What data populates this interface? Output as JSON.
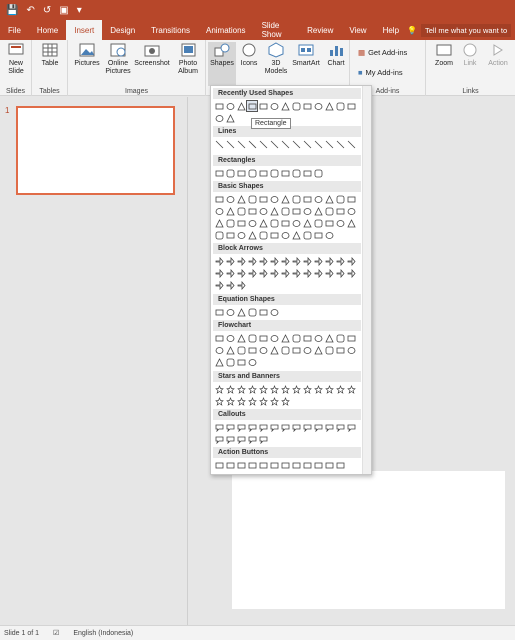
{
  "qat": {
    "title_icons": [
      "save-icon",
      "undo-icon",
      "redo-icon",
      "from-beginning-icon",
      "quick-access-customize-icon"
    ]
  },
  "tabs": [
    {
      "label": "File"
    },
    {
      "label": "Home"
    },
    {
      "label": "Insert"
    },
    {
      "label": "Design"
    },
    {
      "label": "Transitions"
    },
    {
      "label": "Animations"
    },
    {
      "label": "Slide Show"
    },
    {
      "label": "Review"
    },
    {
      "label": "View"
    },
    {
      "label": "Help"
    }
  ],
  "tellme": {
    "text": "Tell me what you want to"
  },
  "ribbon": {
    "new_slide": "New Slide",
    "table": "Table",
    "pictures": "Pictures",
    "online_pictures": "Online Pictures",
    "screenshot": "Screenshot",
    "photo_album": "Photo Album",
    "shapes": "Shapes",
    "icons": "Icons",
    "models_3d": "3D Models",
    "smartart": "SmartArt",
    "chart": "Chart",
    "get_addins": "Get Add-ins",
    "my_addins": "My Add-ins",
    "zoom": "Zoom",
    "link": "Link",
    "action": "Action",
    "groups": {
      "slides": "Slides",
      "tables": "Tables",
      "images": "Images",
      "addins": "Add-ins",
      "links": "Links"
    }
  },
  "slides": {
    "number": "1"
  },
  "gallery": {
    "sections": [
      {
        "title": "Recently Used Shapes"
      },
      {
        "title": "Lines"
      },
      {
        "title": "Rectangles"
      },
      {
        "title": "Basic Shapes"
      },
      {
        "title": "Block Arrows"
      },
      {
        "title": "Equation Shapes"
      },
      {
        "title": "Flowchart"
      },
      {
        "title": "Stars and Banners"
      },
      {
        "title": "Callouts"
      },
      {
        "title": "Action Buttons"
      }
    ],
    "tooltip": "Rectangle"
  },
  "status": {
    "slide_count": "Slide 1 of 1",
    "language": "English (Indonesia)"
  },
  "colors": {
    "accent": "#b7472a",
    "selection": "#e06c48"
  }
}
